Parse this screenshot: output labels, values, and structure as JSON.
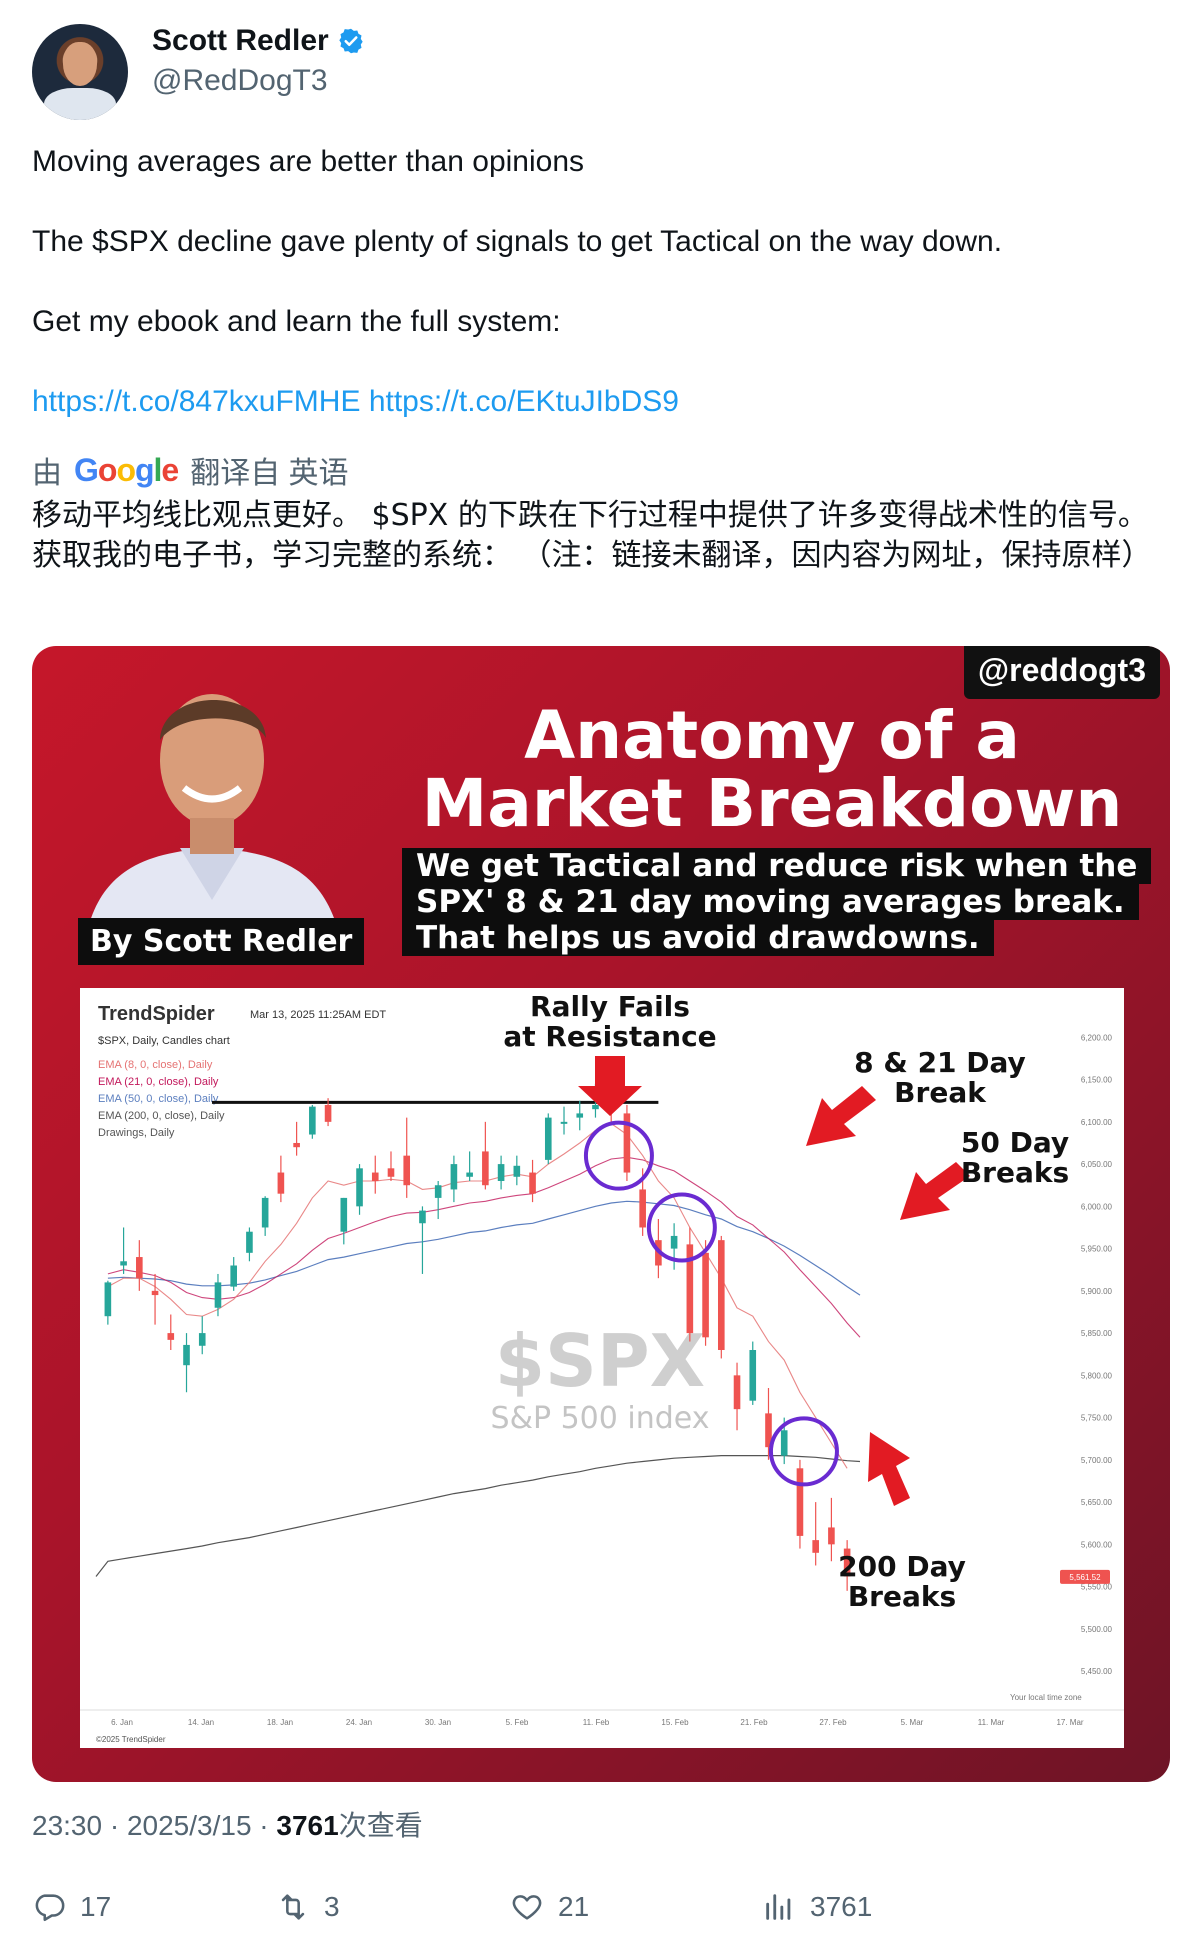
{
  "author": {
    "name": "Scott Redler",
    "handle": "@RedDogT3"
  },
  "tweet": {
    "line1": "Moving averages are better than opinions",
    "line2": "The $SPX decline gave plenty of signals to get Tactical on the way down.",
    "line3": "Get my ebook and learn the full system:",
    "link1": "https://t.co/847kxuFMHE",
    "link2": "https://t.co/EKtuJIbDS9"
  },
  "translation": {
    "by": "由",
    "google": "Google",
    "from": "翻译自 英语",
    "text": "移动平均线比观点更好。 $SPX 的下跌在下行过程中提供了许多变得战术性的信号。 获取我的电子书，学习完整的系统： （注：链接未翻译，因内容为网址，保持原样）"
  },
  "card": {
    "tag": "@reddogt3",
    "title_line1": "Anatomy of a",
    "title_line2": "Market Breakdown",
    "sub_line1": "We get Tactical and reduce risk when the",
    "sub_line2": "SPX' 8 & 21 day moving averages break.",
    "sub_line3": "That helps us avoid drawdowns.",
    "by": "By Scott Redler"
  },
  "chart": {
    "brand": "TrendSpider",
    "date": "Mar 13, 2025 11:25AM EDT",
    "symbol": "$SPX, Daily, Candles chart",
    "ema8": "EMA (8, 0, close), Daily",
    "ema21": "EMA (21, 0, close), Daily",
    "ema50": "EMA (50, 0, close), Daily",
    "ema200": "EMA (200, 0, close), Daily",
    "drawings": "Drawings, Daily",
    "watermark": "$SPX",
    "watermark_sub": "S&P 500 index",
    "annot_rally1": "Rally Fails",
    "annot_rally2": "at Resistance",
    "annot_821a": "8 & 21 Day",
    "annot_821b": "Break",
    "annot_50a": "50 Day",
    "annot_50b": "Breaks",
    "annot_200a": "200 Day",
    "annot_200b": "Breaks",
    "tz": "Your local time zone",
    "copyright": "©2025 TrendSpider",
    "last_price": "5,561.52",
    "colors": {
      "up": "#26a69a",
      "down": "#ef5350",
      "ema8": "#e57373",
      "ema21": "#c2185b",
      "ema50": "#5c7fbf",
      "ema200": "#555555",
      "circle": "#6a2bd1"
    }
  },
  "chart_data": {
    "type": "candlestick",
    "title": "$SPX, Daily, Candles chart",
    "x_ticks": [
      "6. Jan",
      "14. Jan",
      "18. Jan",
      "24. Jan",
      "30. Jan",
      "5. Feb",
      "11. Feb",
      "15. Feb",
      "21. Feb",
      "27. Feb",
      "5. Mar",
      "11. Mar",
      "17. Mar"
    ],
    "y_ticks": [
      "6,200.00",
      "6,150.00",
      "6,100.00",
      "6,050.00",
      "6,000.00",
      "5,950.00",
      "5,900.00",
      "5,850.00",
      "5,800.00",
      "5,750.00",
      "5,700.00",
      "5,650.00",
      "5,600.00",
      "5,550.00",
      "5,500.00",
      "5,450.00"
    ],
    "ylim": [
      5430,
      6230
    ],
    "resistance": 6123,
    "candles": [
      {
        "o": 5870,
        "h": 5912,
        "l": 5860,
        "c": 5910
      },
      {
        "o": 5930,
        "h": 5975,
        "l": 5920,
        "c": 5935
      },
      {
        "o": 5940,
        "h": 5960,
        "l": 5900,
        "c": 5915
      },
      {
        "o": 5900,
        "h": 5920,
        "l": 5860,
        "c": 5895
      },
      {
        "o": 5850,
        "h": 5872,
        "l": 5830,
        "c": 5842
      },
      {
        "o": 5812,
        "h": 5850,
        "l": 5780,
        "c": 5836
      },
      {
        "o": 5835,
        "h": 5870,
        "l": 5825,
        "c": 5850
      },
      {
        "o": 5880,
        "h": 5920,
        "l": 5870,
        "c": 5910
      },
      {
        "o": 5905,
        "h": 5940,
        "l": 5900,
        "c": 5930
      },
      {
        "o": 5945,
        "h": 5975,
        "l": 5935,
        "c": 5970
      },
      {
        "o": 5975,
        "h": 6012,
        "l": 5965,
        "c": 6010
      },
      {
        "o": 6040,
        "h": 6060,
        "l": 6005,
        "c": 6015
      },
      {
        "o": 6075,
        "h": 6100,
        "l": 6060,
        "c": 6070
      },
      {
        "o": 6085,
        "h": 6120,
        "l": 6080,
        "c": 6118
      },
      {
        "o": 6120,
        "h": 6128,
        "l": 6095,
        "c": 6100
      },
      {
        "o": 5970,
        "h": 6010,
        "l": 5955,
        "c": 6010
      },
      {
        "o": 6000,
        "h": 6050,
        "l": 5990,
        "c": 6045
      },
      {
        "o": 6040,
        "h": 6060,
        "l": 6015,
        "c": 6030
      },
      {
        "o": 6045,
        "h": 6065,
        "l": 6030,
        "c": 6035
      },
      {
        "o": 6060,
        "h": 6105,
        "l": 6010,
        "c": 6025
      },
      {
        "o": 5980,
        "h": 6000,
        "l": 5920,
        "c": 5995
      },
      {
        "o": 6010,
        "h": 6030,
        "l": 5985,
        "c": 6025
      },
      {
        "o": 6020,
        "h": 6060,
        "l": 6005,
        "c": 6050
      },
      {
        "o": 6035,
        "h": 6065,
        "l": 6030,
        "c": 6040
      },
      {
        "o": 6065,
        "h": 6100,
        "l": 6020,
        "c": 6025
      },
      {
        "o": 6030,
        "h": 6060,
        "l": 6020,
        "c": 6050
      },
      {
        "o": 6035,
        "h": 6060,
        "l": 6025,
        "c": 6048
      },
      {
        "o": 6040,
        "h": 6055,
        "l": 6005,
        "c": 6015
      },
      {
        "o": 6055,
        "h": 6110,
        "l": 6050,
        "c": 6105
      },
      {
        "o": 6098,
        "h": 6118,
        "l": 6085,
        "c": 6100
      },
      {
        "o": 6105,
        "h": 6125,
        "l": 6090,
        "c": 6110
      },
      {
        "o": 6115,
        "h": 6145,
        "l": 6105,
        "c": 6120
      },
      {
        "o": 6125,
        "h": 6132,
        "l": 6100,
        "c": 6115
      },
      {
        "o": 6110,
        "h": 6120,
        "l": 6030,
        "c": 6040
      },
      {
        "o": 6020,
        "h": 6045,
        "l": 5965,
        "c": 5975
      },
      {
        "o": 5960,
        "h": 5985,
        "l": 5915,
        "c": 5930
      },
      {
        "o": 5950,
        "h": 5980,
        "l": 5925,
        "c": 5965
      },
      {
        "o": 5955,
        "h": 5975,
        "l": 5840,
        "c": 5850
      },
      {
        "o": 5945,
        "h": 5960,
        "l": 5835,
        "c": 5845
      },
      {
        "o": 5960,
        "h": 5965,
        "l": 5820,
        "c": 5830
      },
      {
        "o": 5800,
        "h": 5815,
        "l": 5735,
        "c": 5760
      },
      {
        "o": 5770,
        "h": 5840,
        "l": 5765,
        "c": 5830
      },
      {
        "o": 5755,
        "h": 5785,
        "l": 5700,
        "c": 5715
      },
      {
        "o": 5705,
        "h": 5750,
        "l": 5695,
        "c": 5735
      },
      {
        "o": 5690,
        "h": 5700,
        "l": 5595,
        "c": 5610
      },
      {
        "o": 5605,
        "h": 5650,
        "l": 5575,
        "c": 5590
      },
      {
        "o": 5620,
        "h": 5655,
        "l": 5580,
        "c": 5600
      },
      {
        "o": 5595,
        "h": 5605,
        "l": 5545,
        "c": 5562
      }
    ],
    "ema8": [
      5905,
      5915,
      5915,
      5905,
      5890,
      5872,
      5870,
      5878,
      5890,
      5910,
      5935,
      5955,
      5980,
      6010,
      6030,
      6025,
      6030,
      6030,
      6032,
      6030,
      6020,
      6022,
      6028,
      6030,
      6030,
      6035,
      6038,
      6035,
      6050,
      6062,
      6075,
      6090,
      6098,
      6085,
      6060,
      6030,
      6010,
      5975,
      5945,
      5915,
      5880,
      5870,
      5840,
      5818,
      5780,
      5750,
      5720,
      5690
    ],
    "ema21": [
      5920,
      5925,
      5922,
      5918,
      5910,
      5898,
      5892,
      5890,
      5892,
      5898,
      5908,
      5920,
      5932,
      5948,
      5962,
      5968,
      5975,
      5982,
      5988,
      5992,
      5993,
      5996,
      6000,
      6004,
      6006,
      6010,
      6013,
      6015,
      6022,
      6030,
      6038,
      6048,
      6056,
      6058,
      6055,
      6048,
      6042,
      6030,
      6018,
      6005,
      5988,
      5978,
      5962,
      5946,
      5925,
      5905,
      5885,
      5862
    ],
    "ema50": [
      5915,
      5916,
      5915,
      5914,
      5912,
      5908,
      5906,
      5906,
      5907,
      5909,
      5913,
      5918,
      5923,
      5930,
      5937,
      5940,
      5944,
      5948,
      5952,
      5956,
      5958,
      5961,
      5965,
      5969,
      5971,
      5975,
      5978,
      5980,
      5985,
      5990,
      5995,
      6000,
      6004,
      6006,
      6005,
      6003,
      6001,
      5996,
      5990,
      5985,
      5976,
      5970,
      5962,
      5953,
      5942,
      5930,
      5918,
      5905
    ],
    "ema200": [
      5580,
      5583,
      5586,
      5589,
      5592,
      5595,
      5598,
      5602,
      5605,
      5608,
      5612,
      5616,
      5620,
      5624,
      5628,
      5632,
      5636,
      5640,
      5644,
      5648,
      5652,
      5656,
      5660,
      5663,
      5666,
      5670,
      5673,
      5676,
      5680,
      5683,
      5686,
      5690,
      5693,
      5696,
      5698,
      5700,
      5702,
      5703,
      5704,
      5705,
      5705,
      5705,
      5705,
      5705,
      5704,
      5703,
      5701,
      5699
    ],
    "circles_at_index": [
      33,
      37,
      44
    ]
  },
  "footer": {
    "time": "23:30 · 2025/3/15 · ",
    "views": "3761",
    "views_suffix": "次查看"
  },
  "actions": {
    "replies": "17",
    "retweets": "3",
    "likes": "21",
    "views": "3761"
  }
}
